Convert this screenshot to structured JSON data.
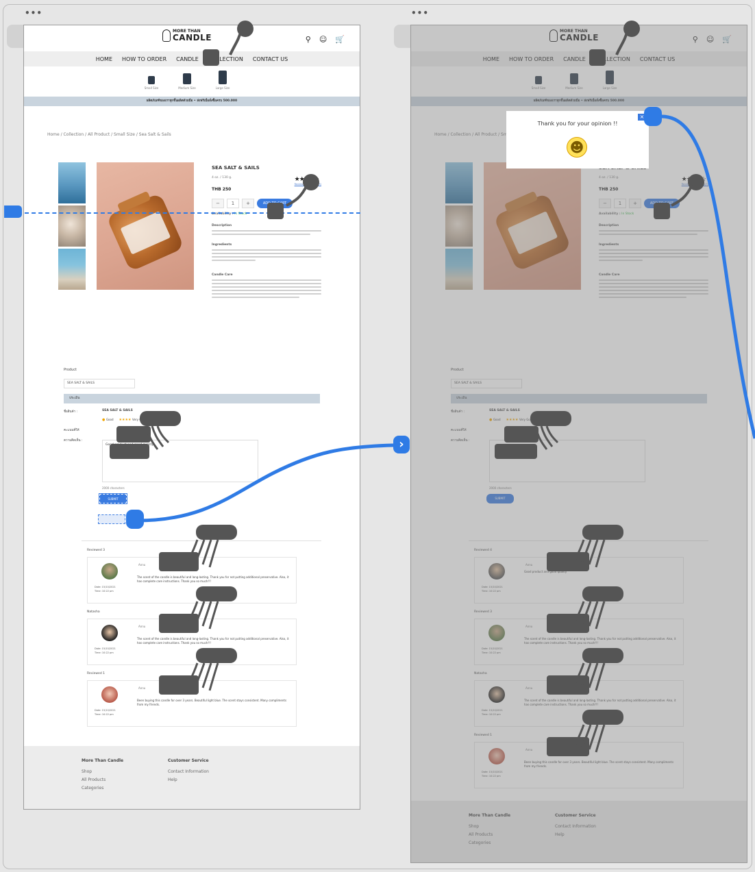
{
  "brand": {
    "line1": "MORE THAN",
    "line2": "CANDLE"
  },
  "header_icons": [
    "search-icon",
    "user-icon",
    "cart-icon"
  ],
  "nav": [
    "HOME",
    "HOW TO ORDER",
    "CANDLE",
    "COLLECTION",
    "CONTACT US"
  ],
  "sizes": [
    "Small Size",
    "Medium Size",
    "Large Size"
  ],
  "breadcrumb": "Home / Collection / All Product / Small Size / Sea Salt & Sails",
  "product": {
    "name": "SEA SALT & SAILS",
    "weight": "4 oz. / 130 g.",
    "rating": "★★★★☆",
    "reviews_link": "Reviews and Rating(3)",
    "price": "THB 250",
    "qty": "1",
    "add_to_cart": "ADD TO CART",
    "availability_label": "Availability :",
    "availability_value": "In Stock",
    "sections": [
      "Description",
      "Ingredients",
      "Candle Care"
    ]
  },
  "review_form": {
    "title": "Product",
    "select_value": "SEA SALT & SAILS",
    "bar_label": "ประเมิน",
    "product_label": "ชื่อสินค้า :",
    "product_value": "SEA SALT & SAILS",
    "rating_label": "คะแนนที่ให้",
    "rating_options": [
      "Good",
      "Very Good",
      "Excellent"
    ],
    "comment_label": "ความคิดเห็น :",
    "comment_value": "Good product and good quality",
    "char_count": "2000 characters",
    "submit": "SUBMIT"
  },
  "reviews": [
    {
      "title": "Reviewed 3",
      "name": "Annu",
      "date": "Date: 15/10/2021",
      "time": "Time: 10:22 pm",
      "text": "The scent of the candle is beautiful and long-lasting. Thank you for not putting additional preservative. Also, it has complete care instructions. Thank you so much!!!"
    },
    {
      "title": "Natasha",
      "name": "Annu",
      "date": "Date: 15/10/2021",
      "time": "Time: 10:22 pm",
      "text": "The scent of the candle is beautiful and long-lasting. Thank you for not putting additional preservative. Also, it has complete care instructions. Thank you so much!!!"
    },
    {
      "title": "Reviewed 1",
      "name": "Annu",
      "date": "Date: 15/10/2021",
      "time": "Time: 10:22 pm",
      "text": "Been buying this candle for over 3 years. Beautiful light blue. The scent stays consistent. Many compliments from my friends."
    }
  ],
  "reviews2_titles": [
    "Reviewed 4",
    "Reviewed 3",
    "Natasha",
    "Reviewed 1"
  ],
  "footer": {
    "col1_title": "More Than Candle",
    "col1_items": [
      "Shop",
      "All Products",
      "Categories"
    ],
    "col2_title": "Customer Service",
    "col2_items": [
      "Contact Information",
      "Help"
    ]
  },
  "popup": {
    "message": "Thank you for your opinion !!"
  },
  "colors": {
    "accent": "#2f7be5",
    "promo_bar": "#c9d4de",
    "success": "#3bb54a"
  }
}
